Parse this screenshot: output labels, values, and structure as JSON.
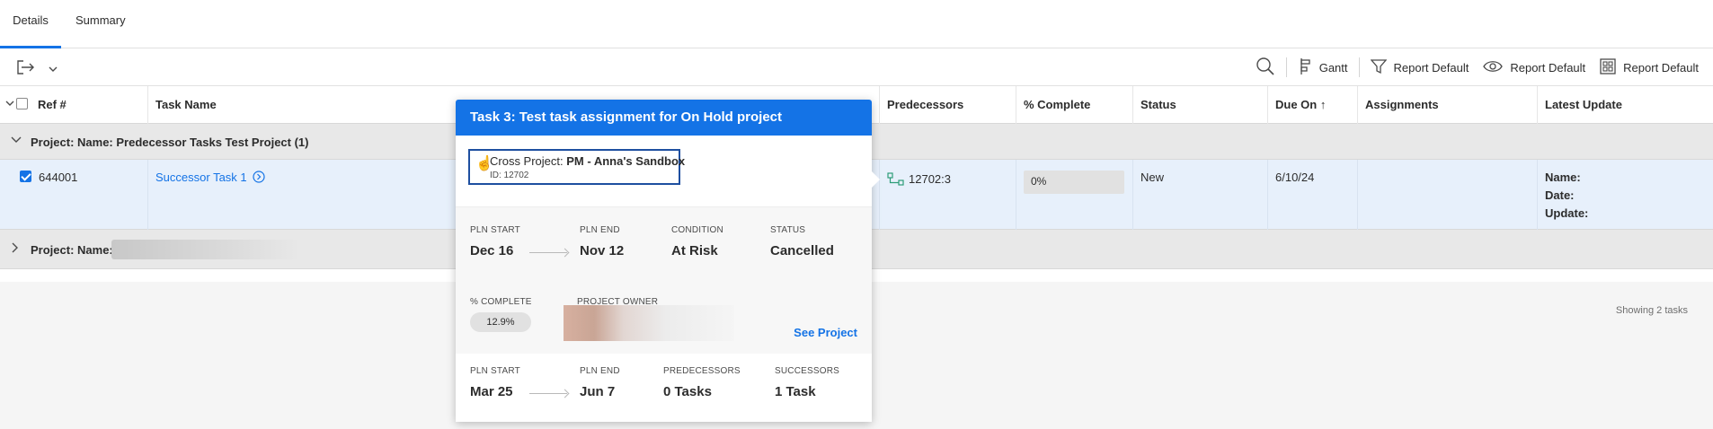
{
  "tabs": [
    {
      "label": "Details",
      "active": true
    },
    {
      "label": "Summary",
      "active": false
    }
  ],
  "toolbar": {
    "gantt_label": "Gantt",
    "filter_label": "Report Default",
    "view_label": "Report Default",
    "grouping_label": "Report Default"
  },
  "columns": {
    "ref": "Ref #",
    "task_name": "Task Name",
    "predecessors": "Predecessors",
    "pct_complete": "% Complete",
    "status": "Status",
    "due_on": "Due On ↑",
    "assignments": "Assignments",
    "latest_update": "Latest Update"
  },
  "groups": [
    {
      "label": "Project: Name: Predecessor Tasks Test Project (1)",
      "expanded": true
    },
    {
      "label": "Project: Name:",
      "expanded": false
    }
  ],
  "row": {
    "ref": "644001",
    "task_name": "Successor Task 1",
    "predecessors": "12702:3",
    "pct_complete": "0%",
    "status": "New",
    "due_on": "6/10/24",
    "assignments": "",
    "latest_update": {
      "name": "Name:",
      "date": "Date:",
      "update": "Update:"
    }
  },
  "footer": {
    "showing": "Showing 2 tasks"
  },
  "popover": {
    "title": "Task 3: Test task assignment for On Hold project",
    "cross_project_prefix": "Cross Project:",
    "cross_project_name": "PM - Anna's Sandbox",
    "cross_project_id": "ID: 12702",
    "task_dates": {
      "pln_start_label": "PLN START",
      "pln_start": "Dec 16",
      "pln_end_label": "PLN END",
      "pln_end": "Nov 12",
      "condition_label": "CONDITION",
      "condition": "At Risk",
      "status_label": "STATUS",
      "status": "Cancelled"
    },
    "pct_complete_label": "% COMPLETE",
    "pct_complete": "12.9%",
    "project_owner_label": "PROJECT OWNER",
    "see_project": "See Project",
    "project_dates": {
      "pln_start_label": "PLN START",
      "pln_start": "Mar 25",
      "pln_end_label": "PLN END",
      "pln_end": "Jun 7",
      "predecessors_label": "PREDECESSORS",
      "predecessors": "0 Tasks",
      "successors_label": "SUCCESSORS",
      "successors": "1 Task"
    }
  },
  "colors": {
    "accent": "#1473e6",
    "row_selected": "#e7f0fb",
    "group_bg": "#e8e8e8"
  }
}
